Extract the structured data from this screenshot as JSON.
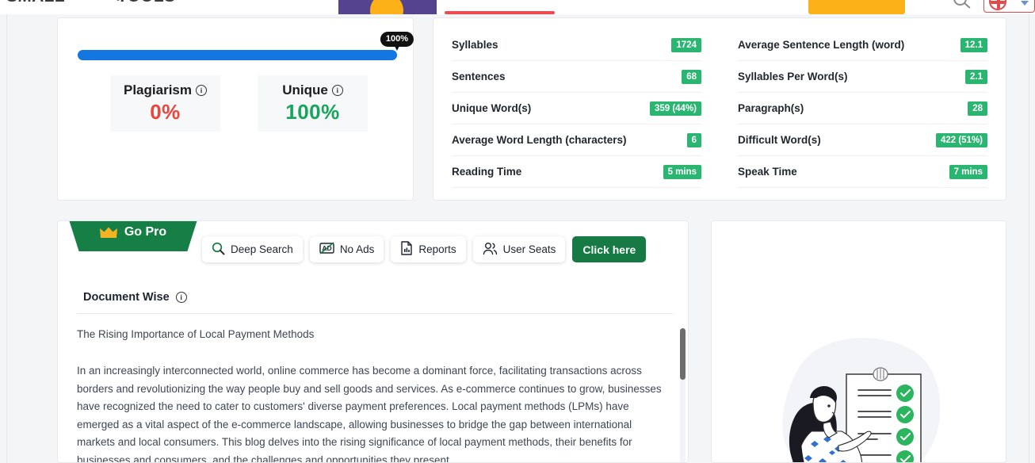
{
  "header": {
    "logo_text_left": "SMALL",
    "logo_text_right": "TOOLS",
    "icons": {
      "search": "search-icon",
      "flag": "flag-icon",
      "caret": "chevron-down-icon"
    }
  },
  "score_card": {
    "progress_percent": 100,
    "progress_tooltip": "100%",
    "boxes": [
      {
        "label": "Plagiarism",
        "value": "0%",
        "color": "#e8453c",
        "info": "info-icon"
      },
      {
        "label": "Unique",
        "value": "100%",
        "color": "#16a55b",
        "info": "info-icon"
      }
    ]
  },
  "stats": {
    "left": [
      {
        "name": "Syllables",
        "value": "1724"
      },
      {
        "name": "Sentences",
        "value": "68"
      },
      {
        "name": "Unique Word(s)",
        "value": "359 (44%)"
      },
      {
        "name": "Average Word Length (characters)",
        "value": "6"
      },
      {
        "name": "Reading Time",
        "value": "5 mins"
      }
    ],
    "right": [
      {
        "name": "Average Sentence Length (word)",
        "value": "12.1"
      },
      {
        "name": "Syllables Per Word(s)",
        "value": "2.1"
      },
      {
        "name": "Paragraph(s)",
        "value": "28"
      },
      {
        "name": "Difficult Word(s)",
        "value": "422 (51%)"
      },
      {
        "name": "Speak Time",
        "value": "7 mins"
      }
    ],
    "badge_color": "#2ab571"
  },
  "pro_bar": {
    "tab_label": "Go Pro",
    "tab_icon": "crown-icon",
    "tab_color": "#167f46",
    "pills": [
      {
        "label": "Deep Search",
        "icon": "search-icon"
      },
      {
        "label": "No Ads",
        "icon": "no-ads-icon"
      },
      {
        "label": "Reports",
        "icon": "report-document-icon"
      },
      {
        "label": "User Seats",
        "icon": "users-icon"
      }
    ],
    "cta_label": "Click here",
    "cta_color": "#177a44"
  },
  "document_wise": {
    "heading": "Document Wise",
    "info_icon": "info-icon",
    "doc_title": "The Rising Importance of Local Payment Methods",
    "doc_paragraph": "In an increasingly interconnected world, online commerce has become a dominant force, facilitating transactions across borders and revolutionizing the way people buy and sell goods and services. As e-commerce continues to grow, businesses have recognized the need to cater to customers' diverse payment preferences. Local payment methods (LPMs) have emerged as a vital aspect of the e-commerce landscape, allowing businesses to bridge the gap between international markets and local consumers. This blog delves into the rising significance of local payment methods, their benefits for businesses and consumers, and the challenges and opportunities they present."
  },
  "illustration": {
    "name": "woman-with-checklist-illustration",
    "check_color": "#2ab55e",
    "hair_color": "#1a1a22",
    "dress_color": "#2f6fd0"
  }
}
